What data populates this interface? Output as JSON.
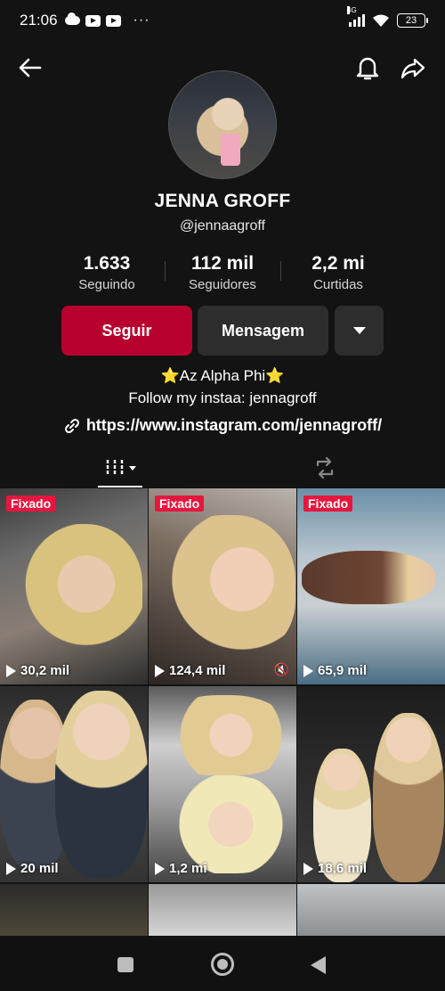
{
  "status": {
    "time": "21:06",
    "network": "4G",
    "battery": "23"
  },
  "profile": {
    "name": "JENNA GROFF",
    "handle": "@jennaagroff",
    "stats": [
      {
        "value": "1.633",
        "label": "Seguindo"
      },
      {
        "value": "112 mil",
        "label": "Seguidores"
      },
      {
        "value": "2,2 mi",
        "label": "Curtidas"
      }
    ],
    "buttons": {
      "follow": "Seguir",
      "message": "Mensagem"
    },
    "bio_line1": "⭐Az Alpha Phi⭐",
    "bio_line2": "Follow my instaa: jennagroff",
    "link": "https://www.instagram.com/jennagroff/"
  },
  "tiles": [
    {
      "pinned": "Fixado",
      "views": "30,2 mil",
      "muted": false
    },
    {
      "pinned": "Fixado",
      "views": "124,4 mil",
      "muted": true
    },
    {
      "pinned": "Fixado",
      "views": "65,9 mil",
      "muted": false
    },
    {
      "pinned": "",
      "views": "20 mil",
      "muted": false
    },
    {
      "pinned": "",
      "views": "1,2 mi",
      "muted": false
    },
    {
      "pinned": "",
      "views": "18,6 mil",
      "muted": false
    }
  ],
  "colors": {
    "accent": "#b8002e",
    "pin": "#e5173f",
    "background": "#131313"
  }
}
